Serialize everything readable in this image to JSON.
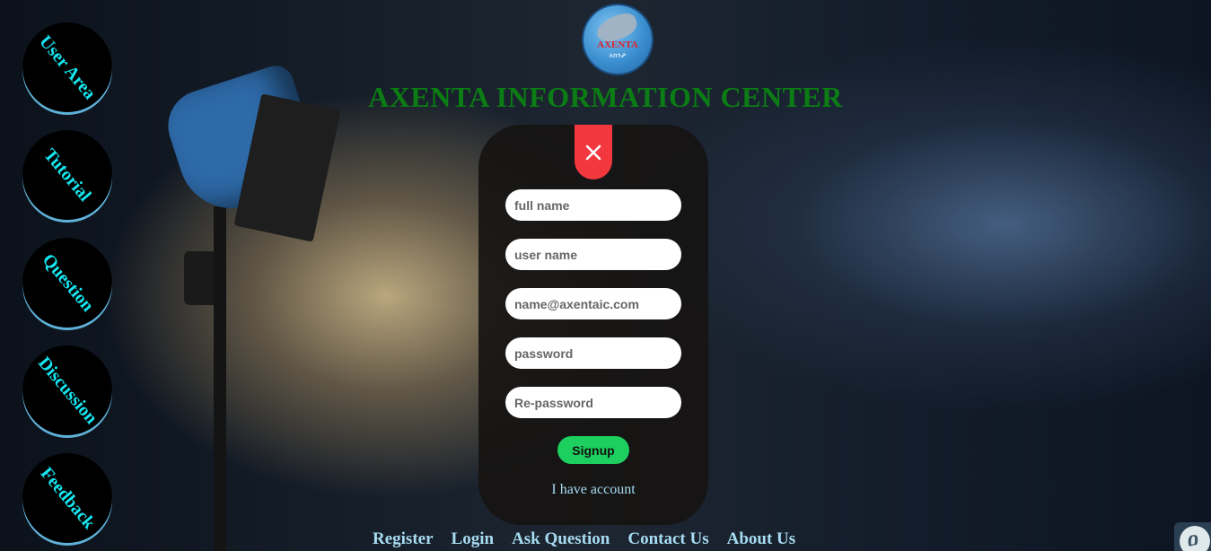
{
  "header": {
    "logo_text": "AXENTA",
    "logo_subtext": "አክንታ",
    "site_title": "AXENTA INFORMATION CENTER"
  },
  "sidebar": {
    "items": [
      {
        "label": "User Area"
      },
      {
        "label": "Tutorial"
      },
      {
        "label": "Question"
      },
      {
        "label": "Discussion"
      },
      {
        "label": "Feedback"
      }
    ]
  },
  "signup_form": {
    "full_name_placeholder": "full name",
    "user_name_placeholder": "user name",
    "email_placeholder": "name@axentaic.com",
    "password_placeholder": "password",
    "repassword_placeholder": "Re-password",
    "submit_label": "Signup",
    "have_account_link": "I have account"
  },
  "footer": {
    "links": [
      {
        "label": "Register"
      },
      {
        "label": "Login"
      },
      {
        "label": "Ask Question"
      },
      {
        "label": "Contact Us"
      },
      {
        "label": "About Us"
      }
    ]
  },
  "corner_badge": {
    "glyph": "ዐ"
  },
  "colors": {
    "title_green": "#0b7d14",
    "sidebar_text_cyan": "#16e6f0",
    "close_red": "#f2373f",
    "signup_green": "#1ccf5e",
    "link_blue": "#a7dcf2"
  },
  "icons": {
    "close": "close-icon"
  }
}
